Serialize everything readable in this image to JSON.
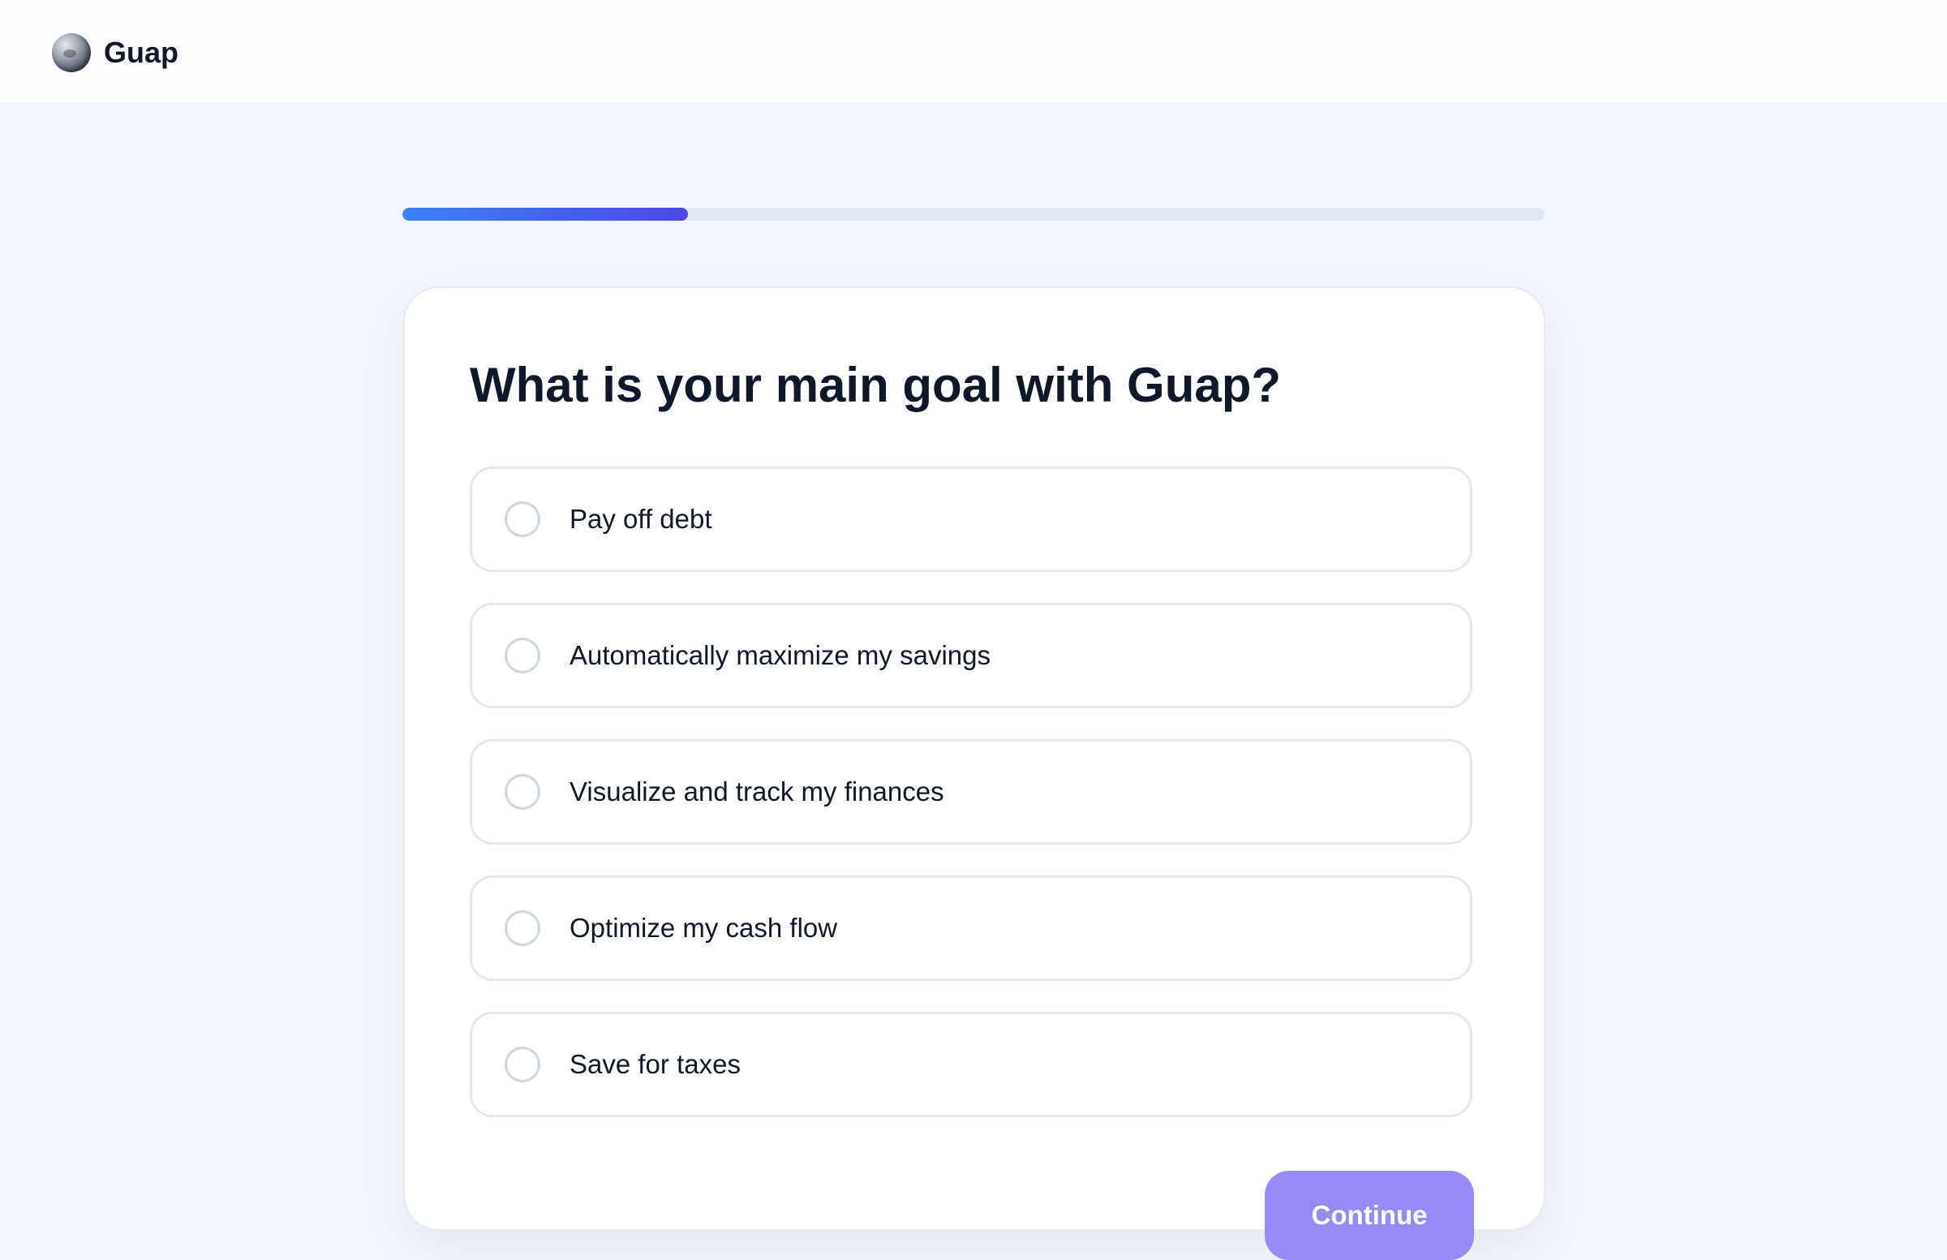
{
  "header": {
    "brand": "Guap",
    "logo_icon": "globe-logo-icon"
  },
  "progress": {
    "fraction": 0.25,
    "color_start": "#3b82f6",
    "color_end": "#4f46e5"
  },
  "question": {
    "title": "What is your main goal with Guap?",
    "options": [
      {
        "label": "Pay off debt",
        "selected": false
      },
      {
        "label": "Automatically maximize my savings",
        "selected": false
      },
      {
        "label": "Visualize and track my finances",
        "selected": false
      },
      {
        "label": "Optimize my cash flow",
        "selected": false
      },
      {
        "label": "Save for taxes",
        "selected": false
      }
    ]
  },
  "actions": {
    "continue_label": "Continue",
    "continue_color": "#978af6"
  }
}
